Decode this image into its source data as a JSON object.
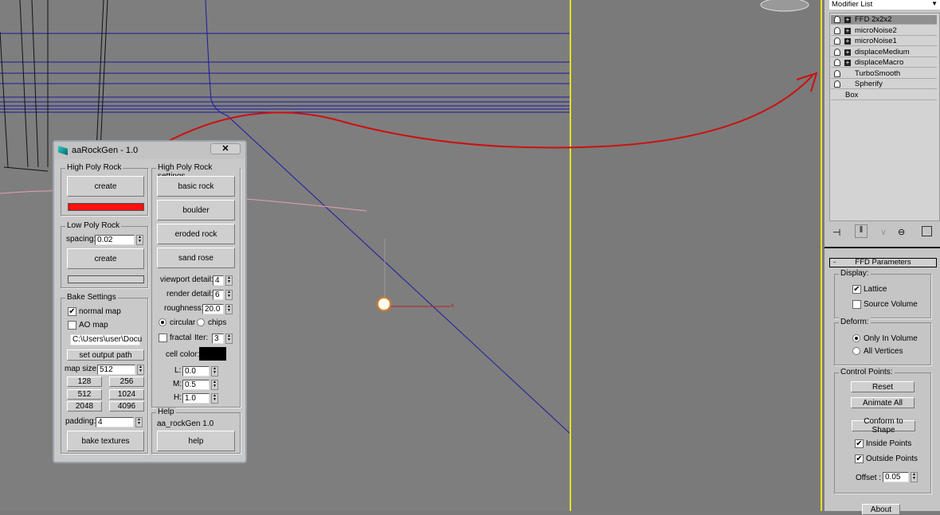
{
  "dialog": {
    "title": "aaRockGen - 1.0",
    "close_label": "✕",
    "high_poly_rock": {
      "label": "High Poly Rock",
      "create": "create",
      "progress_color": "#ff1010"
    },
    "low_poly_rock": {
      "label": "Low Poly Rock",
      "spacing_label": "spacing:",
      "spacing_value": "0.02",
      "create": "create"
    },
    "bake_settings": {
      "label": "Bake Settings",
      "normal_map": "normal map",
      "normal_map_checked": true,
      "ao_map": "AO map",
      "ao_map_checked": false,
      "output_path": "C:\\Users\\user\\Docu",
      "set_output_path": "set output path",
      "map_size_label": "map size:",
      "map_size_value": "512",
      "sizes": [
        "128",
        "256",
        "512",
        "1024",
        "2048",
        "4096"
      ],
      "padding_label": "padding:",
      "padding_value": "4",
      "bake": "bake textures"
    },
    "settings": {
      "label": "High Poly Rock settings",
      "presets": [
        "basic rock",
        "boulder",
        "eroded rock",
        "sand rose"
      ],
      "viewport_detail_label": "viewport detail:",
      "viewport_detail": "4",
      "render_detail_label": "render detail:",
      "render_detail": "6",
      "roughness_label": "roughness:",
      "roughness": "20.0",
      "circular": "circular",
      "chips": "chips",
      "fractal": "fractal",
      "iter_label": "Iter:",
      "iter": "3",
      "cell_color_label": "cell color:",
      "cell_color": "#000000",
      "L_label": "L:",
      "L": "0.0",
      "M_label": "M:",
      "M": "0.5",
      "H_label": "H:",
      "H": "1.0"
    },
    "help": {
      "label": "Help",
      "version": "aa_rockGen 1.0",
      "button": "help"
    }
  },
  "panel": {
    "modifier_list": "Modifier List",
    "stack": [
      {
        "name": "FFD 2x2x2",
        "expand": true,
        "selected": true
      },
      {
        "name": "microNoise2",
        "expand": true
      },
      {
        "name": "microNoise1",
        "expand": true
      },
      {
        "name": "displaceMedium",
        "expand": true
      },
      {
        "name": "displaceMacro",
        "expand": true
      },
      {
        "name": "TurboSmooth",
        "expand": false
      },
      {
        "name": "Spherify",
        "expand": false
      }
    ],
    "base": "Box",
    "rollout": "FFD Parameters",
    "collapse": "-",
    "display_label": "Display:",
    "lattice": "Lattice",
    "source_volume": "Source Volume",
    "deform_label": "Deform:",
    "only_in_volume": "Only In Volume",
    "all_vertices": "All Vertices",
    "control_points_label": "Control Points:",
    "reset": "Reset",
    "animate_all": "Animate All",
    "conform": "Conform to Shape",
    "inside_points": "Inside Points",
    "outside_points": "Outside Points",
    "offset_label": "Offset :",
    "offset": "0.05",
    "about": "About"
  },
  "viewport": {
    "axis_x": "x"
  }
}
